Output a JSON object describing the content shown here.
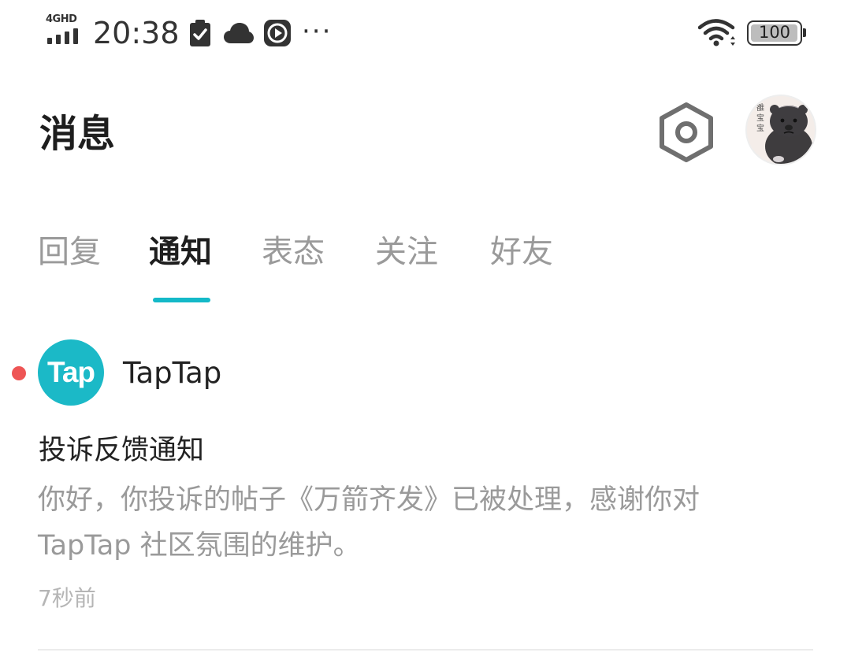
{
  "status_bar": {
    "network": "4GHD",
    "time": "20:38",
    "battery": "100",
    "battery_level": 1.0,
    "icons": [
      "signal-bars-icon",
      "clipboard-check-icon",
      "cloud-icon",
      "play-circle-icon",
      "more-dots-icon",
      "wifi-icon",
      "battery-icon"
    ],
    "more": "···"
  },
  "header": {
    "title": "消息",
    "settings_icon": "hexagon-gear-icon",
    "avatar_icon": "avatar-bear-icon"
  },
  "tabs": [
    {
      "label": "回复",
      "active": false
    },
    {
      "label": "通知",
      "active": true
    },
    {
      "label": "表态",
      "active": false
    },
    {
      "label": "关注",
      "active": false
    },
    {
      "label": "好友",
      "active": false
    }
  ],
  "notification": {
    "unread": true,
    "sender_logo_text": "Tap",
    "sender_name": "TapTap",
    "title": "投诉反馈通知",
    "body_line1": "你好，你投诉的帖子《万箭齐发》已被处理，感谢你对",
    "body_line2": "TapTap 社区氛围的维护。",
    "time": "7秒前"
  },
  "colors": {
    "accent": "#14b9c8",
    "logo_bg": "#1bb9c7",
    "unread_dot": "#ee5555",
    "text_primary": "#1e1e1e",
    "text_secondary": "#9a9a9a"
  }
}
